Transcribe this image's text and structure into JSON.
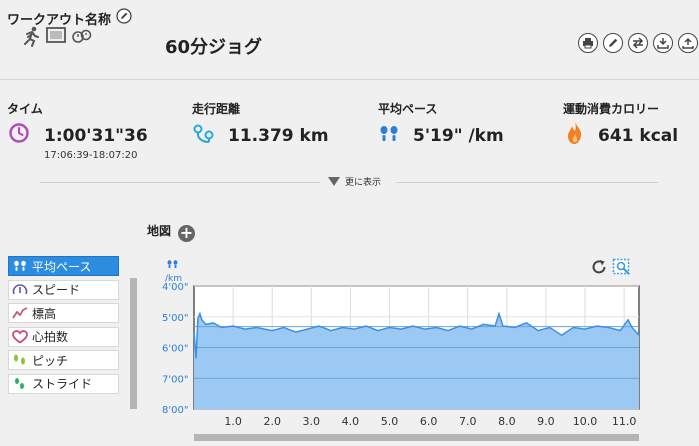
{
  "header": {
    "label": "ワークアウト名称",
    "title": "60分ジョグ",
    "toolbar": [
      "print-icon",
      "edit-icon",
      "transfer-icon",
      "export-icon",
      "upload-icon"
    ]
  },
  "stats": {
    "time": {
      "label": "タイム",
      "value": "1:00'31\"36",
      "range": "17:06:39-18:07:20",
      "icon": "clock-icon",
      "color": "#b04ab8"
    },
    "distance": {
      "label": "走行距離",
      "value": "11.379 km",
      "icon": "route-icon",
      "color": "#2aa8e0"
    },
    "pace": {
      "label": "平均ペース",
      "value": "5'19\" /km",
      "icon": "footsteps-icon",
      "color": "#2c7fd6"
    },
    "calories": {
      "label": "運動消費カロリー",
      "value": "641 kcal",
      "icon": "flame-icon",
      "color": "#f08020"
    }
  },
  "expand_label": "更に表示",
  "map_label": "地図",
  "metrics": [
    {
      "label": "平均ペース",
      "selected": true,
      "icon": "footsteps-icon"
    },
    {
      "label": "スピード",
      "selected": false,
      "icon": "speedometer-icon"
    },
    {
      "label": "標高",
      "selected": false,
      "icon": "elevation-icon"
    },
    {
      "label": "心拍数",
      "selected": false,
      "icon": "heart-icon"
    },
    {
      "label": "ピッチ",
      "selected": false,
      "icon": "footprints-icon"
    },
    {
      "label": "ストライド",
      "selected": false,
      "icon": "stride-icon"
    }
  ],
  "chart_data": {
    "type": "area",
    "ylabel": "/km",
    "y_ticks": [
      "4'00\"",
      "5'00\"",
      "6'00\"",
      "7'00\"",
      "8'00\""
    ],
    "y_tick_values": [
      4,
      5,
      6,
      7,
      8
    ],
    "ylim": [
      4,
      8
    ],
    "y_inverted": true,
    "x_ticks": [
      "1.0",
      "2.0",
      "3.0",
      "4.0",
      "5.0",
      "6.0",
      "7.0",
      "8.0",
      "9.0",
      "10.0",
      "11.0"
    ],
    "x_tick_values": [
      1,
      2,
      3,
      4,
      5,
      6,
      7,
      8,
      9,
      10,
      11
    ],
    "xlim": [
      0,
      11.38
    ],
    "reference_line": 5.32,
    "series": [
      {
        "color": "#3d8fe0",
        "fill": "#9cc8f4",
        "x": [
          0,
          0.05,
          0.1,
          0.15,
          0.2,
          0.3,
          0.5,
          0.7,
          1.0,
          1.3,
          1.6,
          2.0,
          2.3,
          2.6,
          2.9,
          3.2,
          3.5,
          3.8,
          4.1,
          4.4,
          4.7,
          5.0,
          5.3,
          5.6,
          5.9,
          6.2,
          6.5,
          6.8,
          7.1,
          7.4,
          7.7,
          7.8,
          7.9,
          8.2,
          8.5,
          8.8,
          9.1,
          9.4,
          9.7,
          10.0,
          10.3,
          10.6,
          10.9,
          11.1,
          11.2,
          11.38
        ],
        "y": [
          5.5,
          6.35,
          5.05,
          4.9,
          5.1,
          5.25,
          5.2,
          5.35,
          5.3,
          5.4,
          5.35,
          5.45,
          5.35,
          5.5,
          5.4,
          5.3,
          5.45,
          5.35,
          5.4,
          5.3,
          5.45,
          5.35,
          5.4,
          5.3,
          5.4,
          5.35,
          5.45,
          5.3,
          5.4,
          5.25,
          5.3,
          4.9,
          5.3,
          5.35,
          5.2,
          5.45,
          5.35,
          5.6,
          5.35,
          5.4,
          5.3,
          5.35,
          5.45,
          5.1,
          5.35,
          5.6
        ]
      }
    ]
  }
}
